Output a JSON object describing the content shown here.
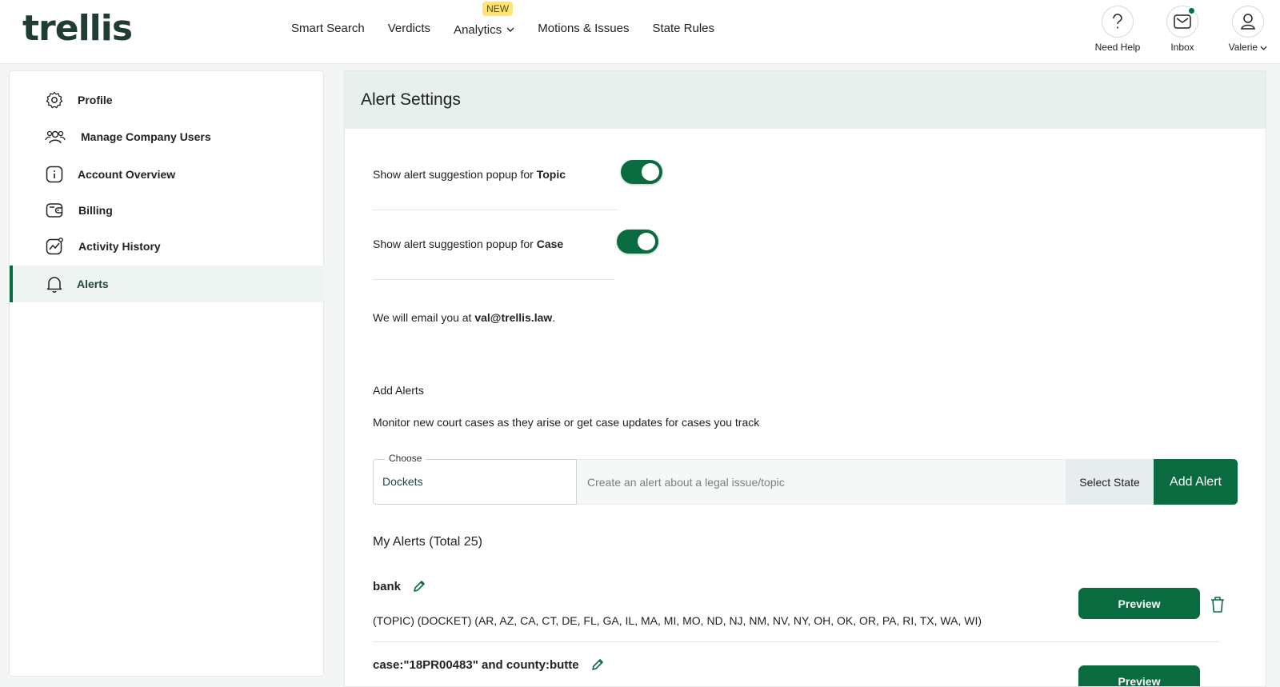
{
  "header": {
    "logo": "trellis",
    "nav": [
      {
        "label": "Smart Search"
      },
      {
        "label": "Verdicts"
      },
      {
        "label": "Analytics",
        "badge": "NEW"
      },
      {
        "label": "Motions & Issues"
      },
      {
        "label": "State Rules"
      }
    ],
    "help_label": "Need Help",
    "inbox_label": "Inbox",
    "user_label": "Valerie",
    "icons": {
      "help": "question-icon",
      "inbox": "mail-icon",
      "user": "user-icon"
    },
    "accent_color": "#0a6b41"
  },
  "sidebar": {
    "items": [
      {
        "label": "Profile",
        "icon": "gear-icon"
      },
      {
        "label": "Manage Company Users",
        "icon": "users-icon"
      },
      {
        "label": "Account Overview",
        "icon": "info-icon"
      },
      {
        "label": "Billing",
        "icon": "wallet-icon"
      },
      {
        "label": "Activity History",
        "icon": "chart-icon"
      },
      {
        "label": "Alerts",
        "icon": "bell-icon",
        "active": true
      }
    ]
  },
  "main": {
    "title": "Alert Settings",
    "toggle_topic": {
      "prefix": "Show alert suggestion popup for ",
      "bold": "Topic",
      "on": true
    },
    "toggle_case": {
      "prefix": "Show alert suggestion popup for ",
      "bold": "Case",
      "on": true
    },
    "email_prefix": "We will email you at ",
    "email": "val@trellis.law",
    "email_suffix": ".",
    "add_alerts_heading": "Add Alerts",
    "add_alerts_desc": "Monitor new court cases as they arise or get case updates for cases you track",
    "form": {
      "choose_label": "Choose",
      "choose_value": "Dockets",
      "topic_placeholder": "Create an alert about a legal issue/topic",
      "select_state_label": "Select State",
      "add_alert_label": "Add Alert"
    },
    "my_alerts_heading": "My Alerts (Total 25)",
    "alerts": [
      {
        "title": "bank",
        "details": "(TOPIC) (DOCKET) (AR, AZ, CA, CT, DE, FL, GA, IL, MA, MI, MO, ND, NJ, NM, NV, NY, OH, OK, OR, PA, RI, TX, WA, WI)",
        "preview_label": "Preview"
      },
      {
        "title": "case:\"18PR00483\" and county:butte",
        "preview_label": "Preview"
      }
    ]
  }
}
